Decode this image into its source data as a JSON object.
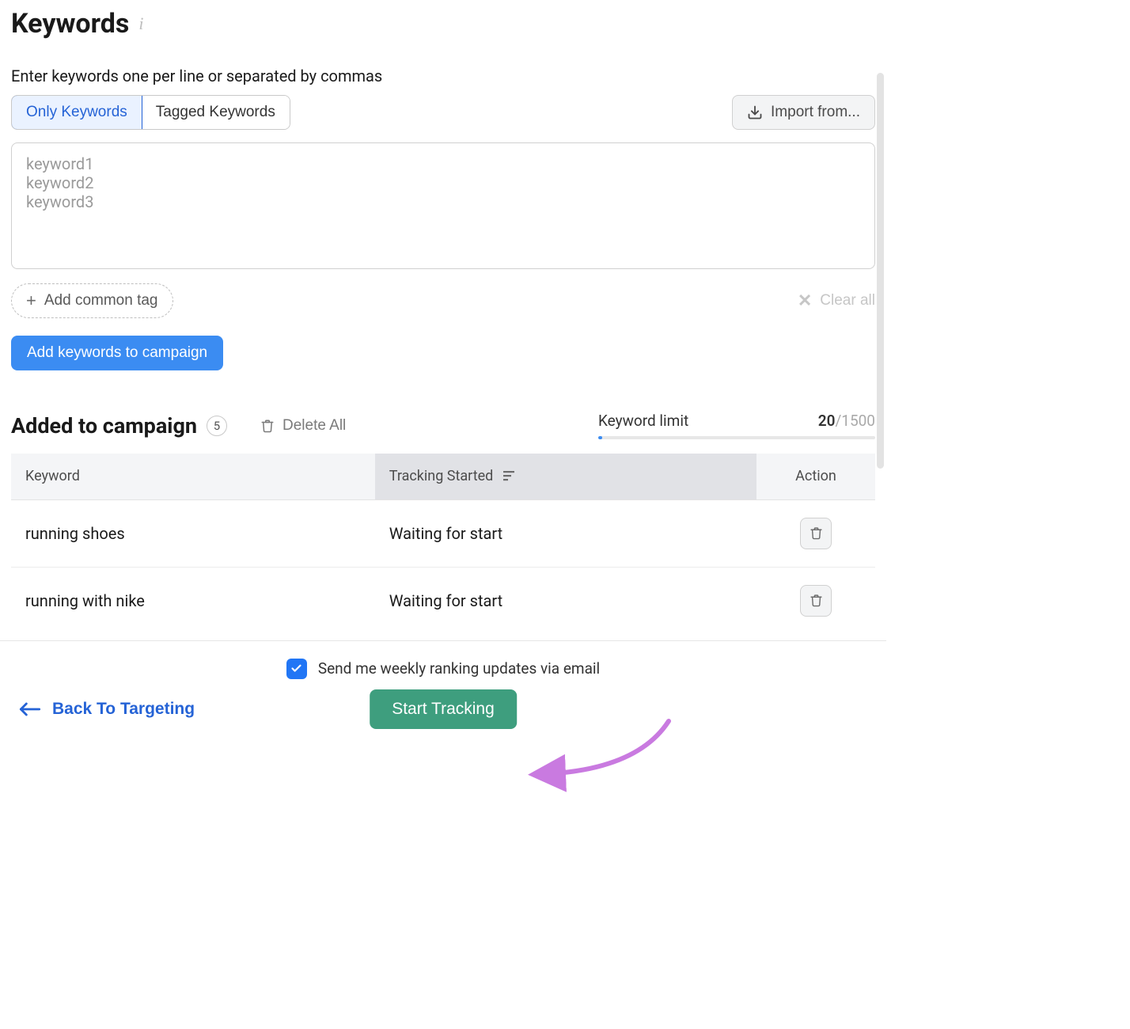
{
  "header": {
    "title": "Keywords",
    "instruction": "Enter keywords one per line or separated by commas"
  },
  "tabs": {
    "only_keywords": "Only Keywords",
    "tagged_keywords": "Tagged Keywords"
  },
  "buttons": {
    "import_from": "Import from...",
    "add_common_tag": "Add common tag",
    "clear_all": "Clear all",
    "add_keywords": "Add keywords to campaign",
    "delete_all": "Delete All",
    "back": "Back To Targeting",
    "start_tracking": "Start Tracking"
  },
  "textarea": {
    "placeholder": "keyword1\nkeyword2\nkeyword3",
    "value": ""
  },
  "added": {
    "title": "Added to campaign",
    "count": "5"
  },
  "keyword_limit": {
    "label": "Keyword limit",
    "current": "20",
    "max": "/1500"
  },
  "table": {
    "headers": {
      "keyword": "Keyword",
      "tracking_started": "Tracking Started",
      "action": "Action"
    },
    "rows": [
      {
        "keyword": "running shoes",
        "tracking": "Waiting for start"
      },
      {
        "keyword": "running with nike",
        "tracking": "Waiting for start"
      }
    ]
  },
  "footer": {
    "checkbox_label": "Send me weekly ranking updates via email"
  }
}
